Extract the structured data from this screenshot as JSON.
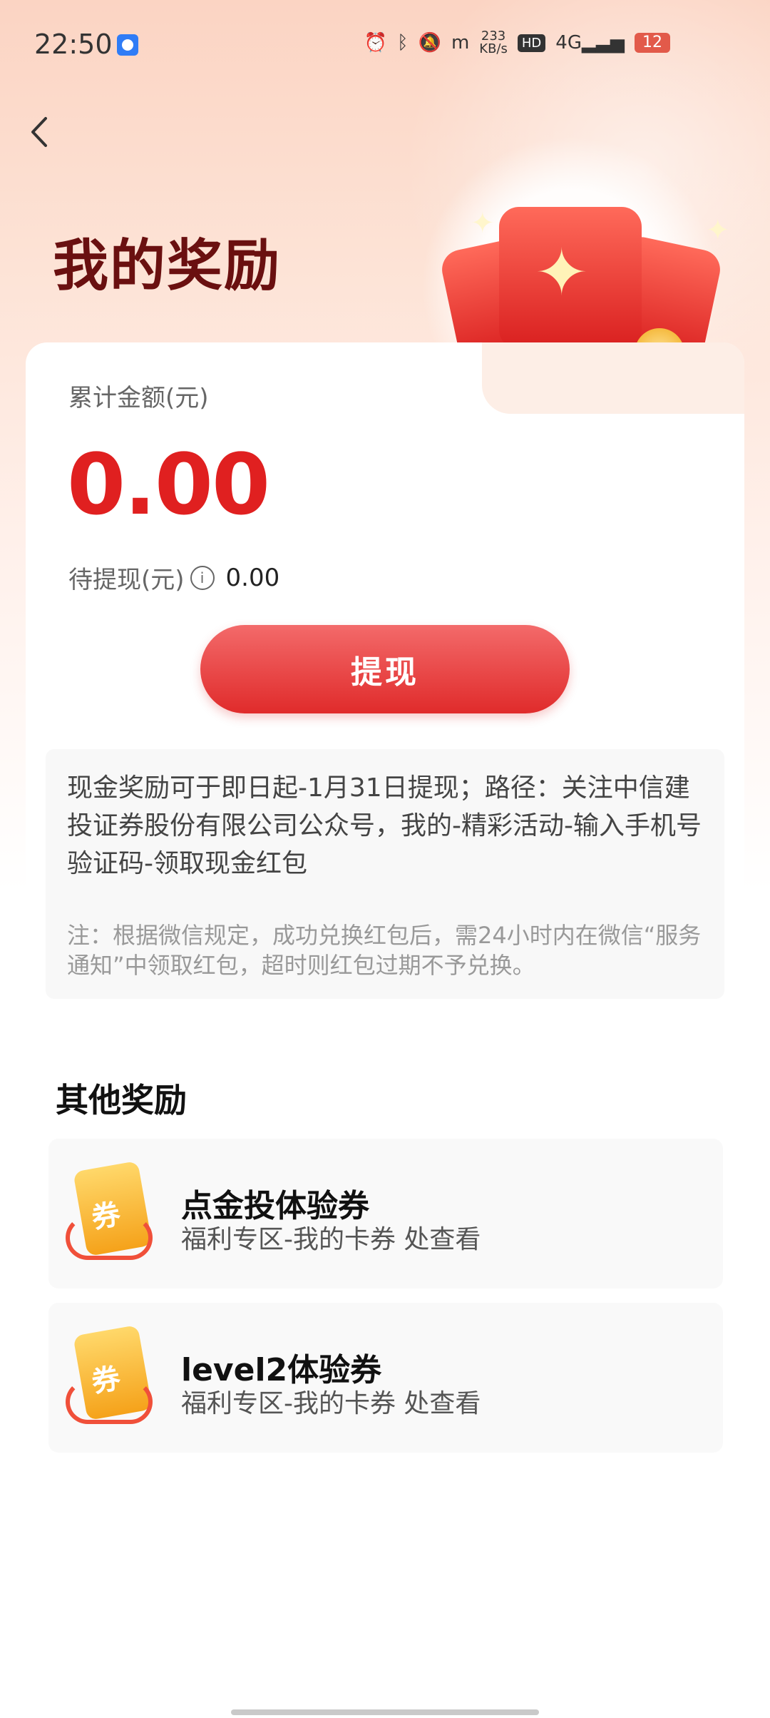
{
  "statusbar": {
    "time": "22:50",
    "net_speed_top": "233",
    "net_speed_bottom": "KB/s",
    "hd": "HD",
    "network": "4G",
    "battery": "12"
  },
  "page": {
    "title": "我的奖励"
  },
  "card": {
    "total_label": "累计金额(元)",
    "total_amount": "0.00",
    "pending_label": "待提现(元)",
    "pending_amount": "0.00",
    "withdraw_button": "提现",
    "notice_main": "现金奖励可于即日起-1月31日提现；路径：关注中信建投证券股份有限公司公众号，我的-精彩活动-输入手机号验证码-领取现金红包",
    "notice_note": "注：根据微信规定，成功兑换红包后，需24小时内在微信“服务通知”中领取红包，超时则红包过期不予兑换。"
  },
  "other_rewards": {
    "title": "其他奖励",
    "items": [
      {
        "title": "点金投体验券",
        "subtitle": "福利专区-我的卡券 处查看",
        "ticket_mark": "券"
      },
      {
        "title": "level2体验券",
        "subtitle": "福利专区-我的卡券 处查看",
        "ticket_mark": "券"
      }
    ]
  },
  "colors": {
    "accent": "#e02020",
    "button": "#e02b2b",
    "title": "#6a1010"
  },
  "icons": {
    "back": "chevron-left-icon",
    "info": "info-icon",
    "hero": "red-envelope-illustration",
    "ticket": "coupon-icon"
  }
}
